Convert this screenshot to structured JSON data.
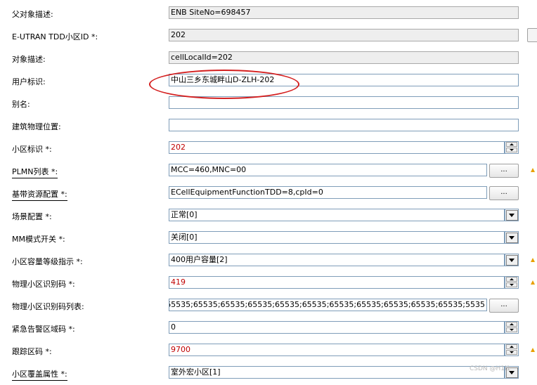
{
  "rows": {
    "parent_desc": {
      "label": "父对象描述:",
      "value": "ENB SiteNo=698457"
    },
    "cell_id": {
      "label": "E-UTRAN TDD小区ID *:",
      "value": "202"
    },
    "obj_desc": {
      "label": "对象描述:",
      "value": "cellLocalId=202"
    },
    "user_label": {
      "label": "用户标识:",
      "value": "中山三乡东城畔山D-ZLH-202"
    },
    "alias": {
      "label": "别名:",
      "value": ""
    },
    "building": {
      "label": "建筑物理位置:",
      "value": ""
    },
    "cell_flag": {
      "label": "小区标识 *:",
      "value": "202"
    },
    "plmn": {
      "label": "PLMN列表 *:",
      "value": "MCC=460,MNC=00",
      "button": "..."
    },
    "baseband": {
      "label": "基带资源配置 *:",
      "value": "ECellEquipmentFunctionTDD=8,cpId=0",
      "button": "..."
    },
    "scene": {
      "label": "场景配置 *:",
      "value": "正常[0]"
    },
    "mm_switch": {
      "label": "MM模式开关 *:",
      "value": "关闭[0]"
    },
    "capacity": {
      "label": "小区容量等级指示 *:",
      "value": "400用户容量[2]"
    },
    "pci": {
      "label": "物理小区识别码 *:",
      "value": "419"
    },
    "pci_list": {
      "label": "物理小区识别码列表:",
      "value": "5535;65535;65535;65535;65535;65535;65535;65535;65535;65535;65535;65535",
      "button": "..."
    },
    "emergency": {
      "label": "紧急告警区域码 *:",
      "value": "0"
    },
    "tac": {
      "label": "跟踪区码 *:",
      "value": "9700"
    },
    "coverage": {
      "label": "小区覆盖属性 *:",
      "value": "室外宏小区[1]"
    }
  },
  "watermark": "CSDN @H1l1",
  "icons": {
    "warning": "warning-triangle-icon",
    "spinner": "spinner-icon",
    "dropdown": "chevron-down-icon"
  },
  "colors": {
    "field_border": "#7f9db9",
    "readonly_bg": "#eeeeee",
    "value_red": "#c00000",
    "highlight_oval": "#d42020",
    "warning": "#e8a000"
  }
}
